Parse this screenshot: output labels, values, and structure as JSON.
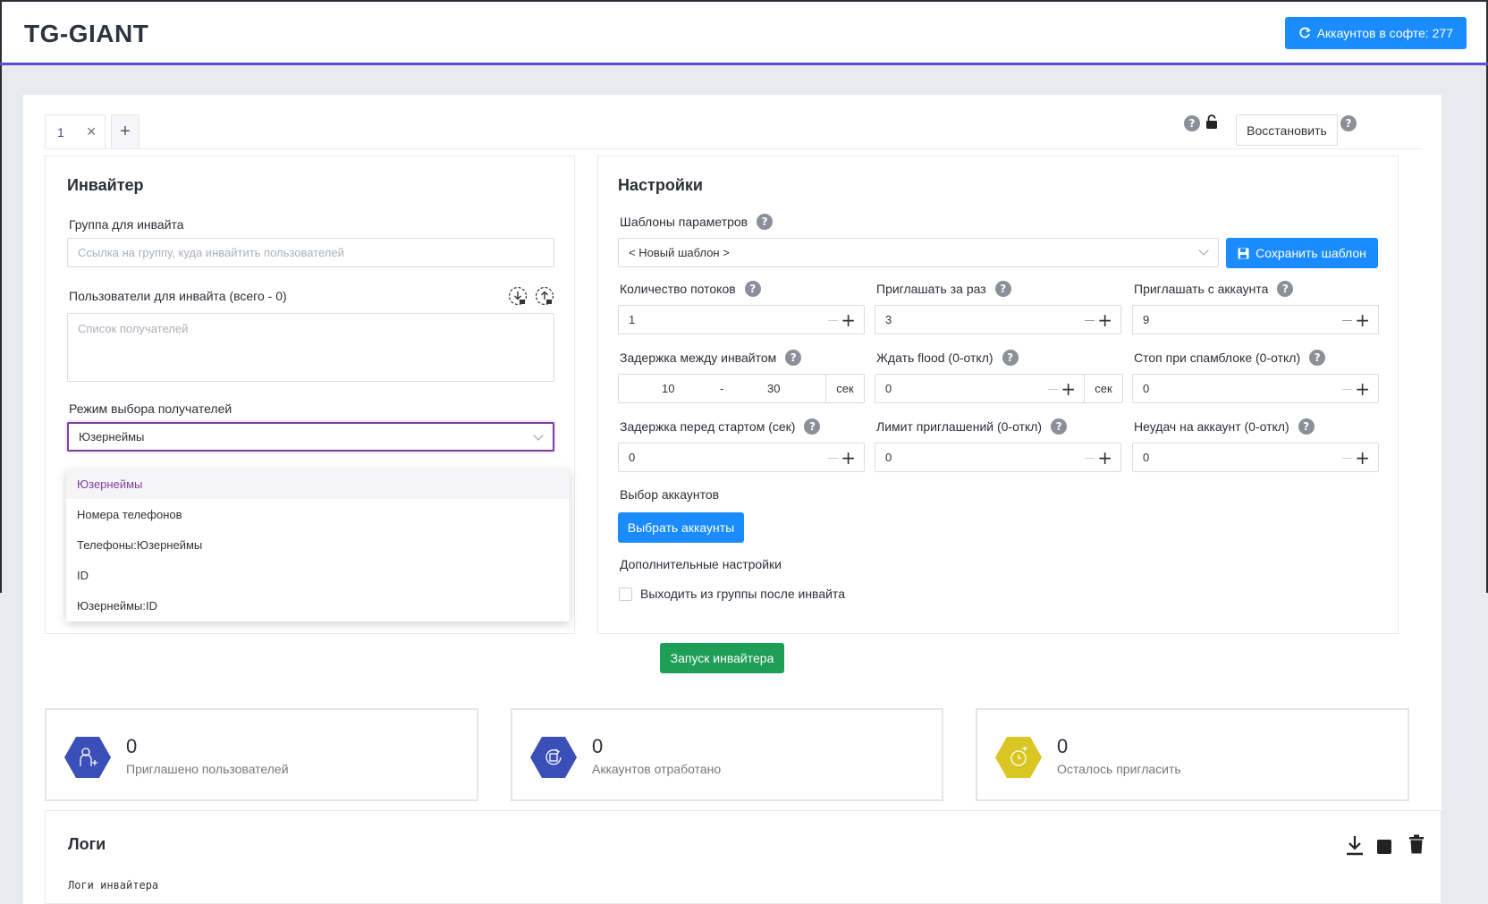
{
  "header": {
    "title": "TG-GIANT",
    "accounts_button": "Аккаунтов в софте: 277"
  },
  "tabs": [
    {
      "label": "1"
    },
    {
      "label": "+"
    }
  ],
  "toolbar": {
    "restore_label": "Восстановить"
  },
  "inviter": {
    "title": "Инвайтер",
    "group_label": "Группа для инвайта",
    "group_placeholder": "Ссылка на группу, куда инвайтить пользователей",
    "users_label": "Пользователи для инвайта (всего - 0)",
    "users_placeholder": "Список получателей",
    "mode_label": "Режим выбора получателей",
    "mode_value": "Юзернеймы",
    "mode_options": [
      "Юзернеймы",
      "Номера телефонов",
      "Телефоны:Юзернеймы",
      "ID",
      "Юзернеймы:ID"
    ]
  },
  "settings": {
    "title": "Настройки",
    "templates_label": "Шаблоны параметров",
    "template_value": "< Новый шаблон >",
    "save_template": "Сохранить шаблон",
    "threads_label": "Количество потоков",
    "threads_value": "1",
    "invite_per_label": "Приглашать за раз",
    "invite_per_value": "3",
    "invite_from_label": "Приглашать с аккаунта",
    "invite_from_value": "9",
    "delay_label": "Задержка между инвайтом",
    "delay_min": "10",
    "delay_dash": "-",
    "delay_max": "30",
    "sec": "сек",
    "flood_label": "Ждать flood (0-откл)",
    "flood_value": "0",
    "spamblock_label": "Стоп при спамблоке (0-откл)",
    "spamblock_value": "0",
    "start_delay_label": "Задержка перед стартом (сек)",
    "start_delay_value": "0",
    "limit_label": "Лимит приглашений (0-откл)",
    "limit_value": "0",
    "fails_label": "Неудач на аккаунт (0-откл)",
    "fails_value": "0",
    "accounts_label": "Выбор аккаунтов",
    "select_accounts": "Выбрать аккаунты",
    "extra_label": "Дополнительные настройки",
    "leave_group_label": "Выходить из группы после инвайта"
  },
  "start_button": "Запуск инвайтера",
  "stats": [
    {
      "value": "0",
      "caption": "Приглашено пользователей",
      "color": "#3a4fb8"
    },
    {
      "value": "0",
      "caption": "Аккаунтов отработано",
      "color": "#3a4fb8"
    },
    {
      "value": "0",
      "caption": "Осталось пригласить",
      "color": "#d9c623"
    }
  ],
  "logs": {
    "title": "Логи",
    "subtitle": "Логи инвайтера"
  }
}
